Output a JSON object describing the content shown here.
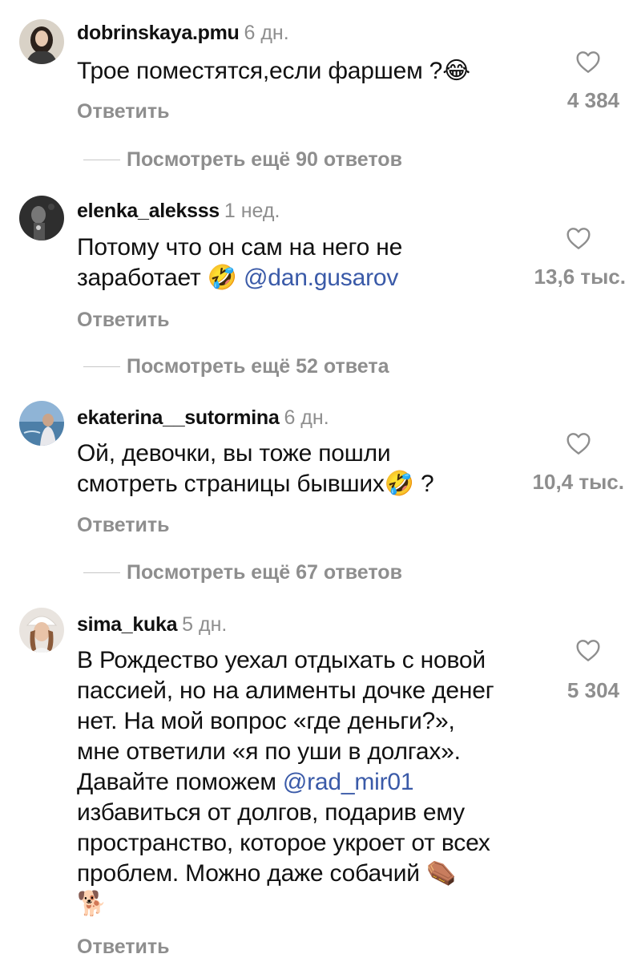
{
  "comments": [
    {
      "username": "dobrinskaya.pmu",
      "time": "6 дн.",
      "text": "Трое поместятся,если фаршем ?😂",
      "reply_label": "Ответить",
      "likes": "4 384",
      "more_replies": "Посмотреть ещё 90 ответов",
      "avatar_icon": "avatar-photo-dark-hair"
    },
    {
      "username": "elenka_aleksss",
      "time": "1 нед.",
      "text_line1": "Потому что он сам на него не",
      "text_line2": "заработает 🤣 ",
      "mention": "@dan.gusarov",
      "reply_label": "Ответить",
      "likes": "13,6 тыс.",
      "more_replies": "Посмотреть ещё 52 ответа",
      "avatar_icon": "avatar-photo-monochrome"
    },
    {
      "username": "ekaterina__sutormina",
      "time": "6 дн.",
      "text_line1": "Ой, девочки, вы тоже пошли",
      "text_line2": "смотреть страницы бывших🤣 ?",
      "reply_label": "Ответить",
      "likes": "10,4 тыс.",
      "more_replies": "Посмотреть ещё 67 ответов",
      "avatar_icon": "avatar-photo-sea"
    },
    {
      "username": "sima_kuka",
      "time": "5 дн.",
      "lines": [
        "В Рождество уехал отдыхать с новой",
        "пассией, но на алименты дочке денег",
        "нет. На мой вопрос «где деньги?»,",
        "мне ответили «я по уши в долгах».",
        "Давайте поможем "
      ],
      "mention": "@rad_mir01",
      "lines_after": [
        "избавиться от долгов, подарив ему",
        "пространство, которое укроет от всех",
        "проблем. Можно даже собачий ⚰️",
        "🐕"
      ],
      "reply_label": "Ответить",
      "likes": "5 304",
      "avatar_icon": "avatar-photo-white-hat"
    }
  ],
  "colors": {
    "text": "#111111",
    "secondary": "#8e8e8e",
    "mention": "#3a5aa8",
    "divider": "#c7c7c7"
  }
}
